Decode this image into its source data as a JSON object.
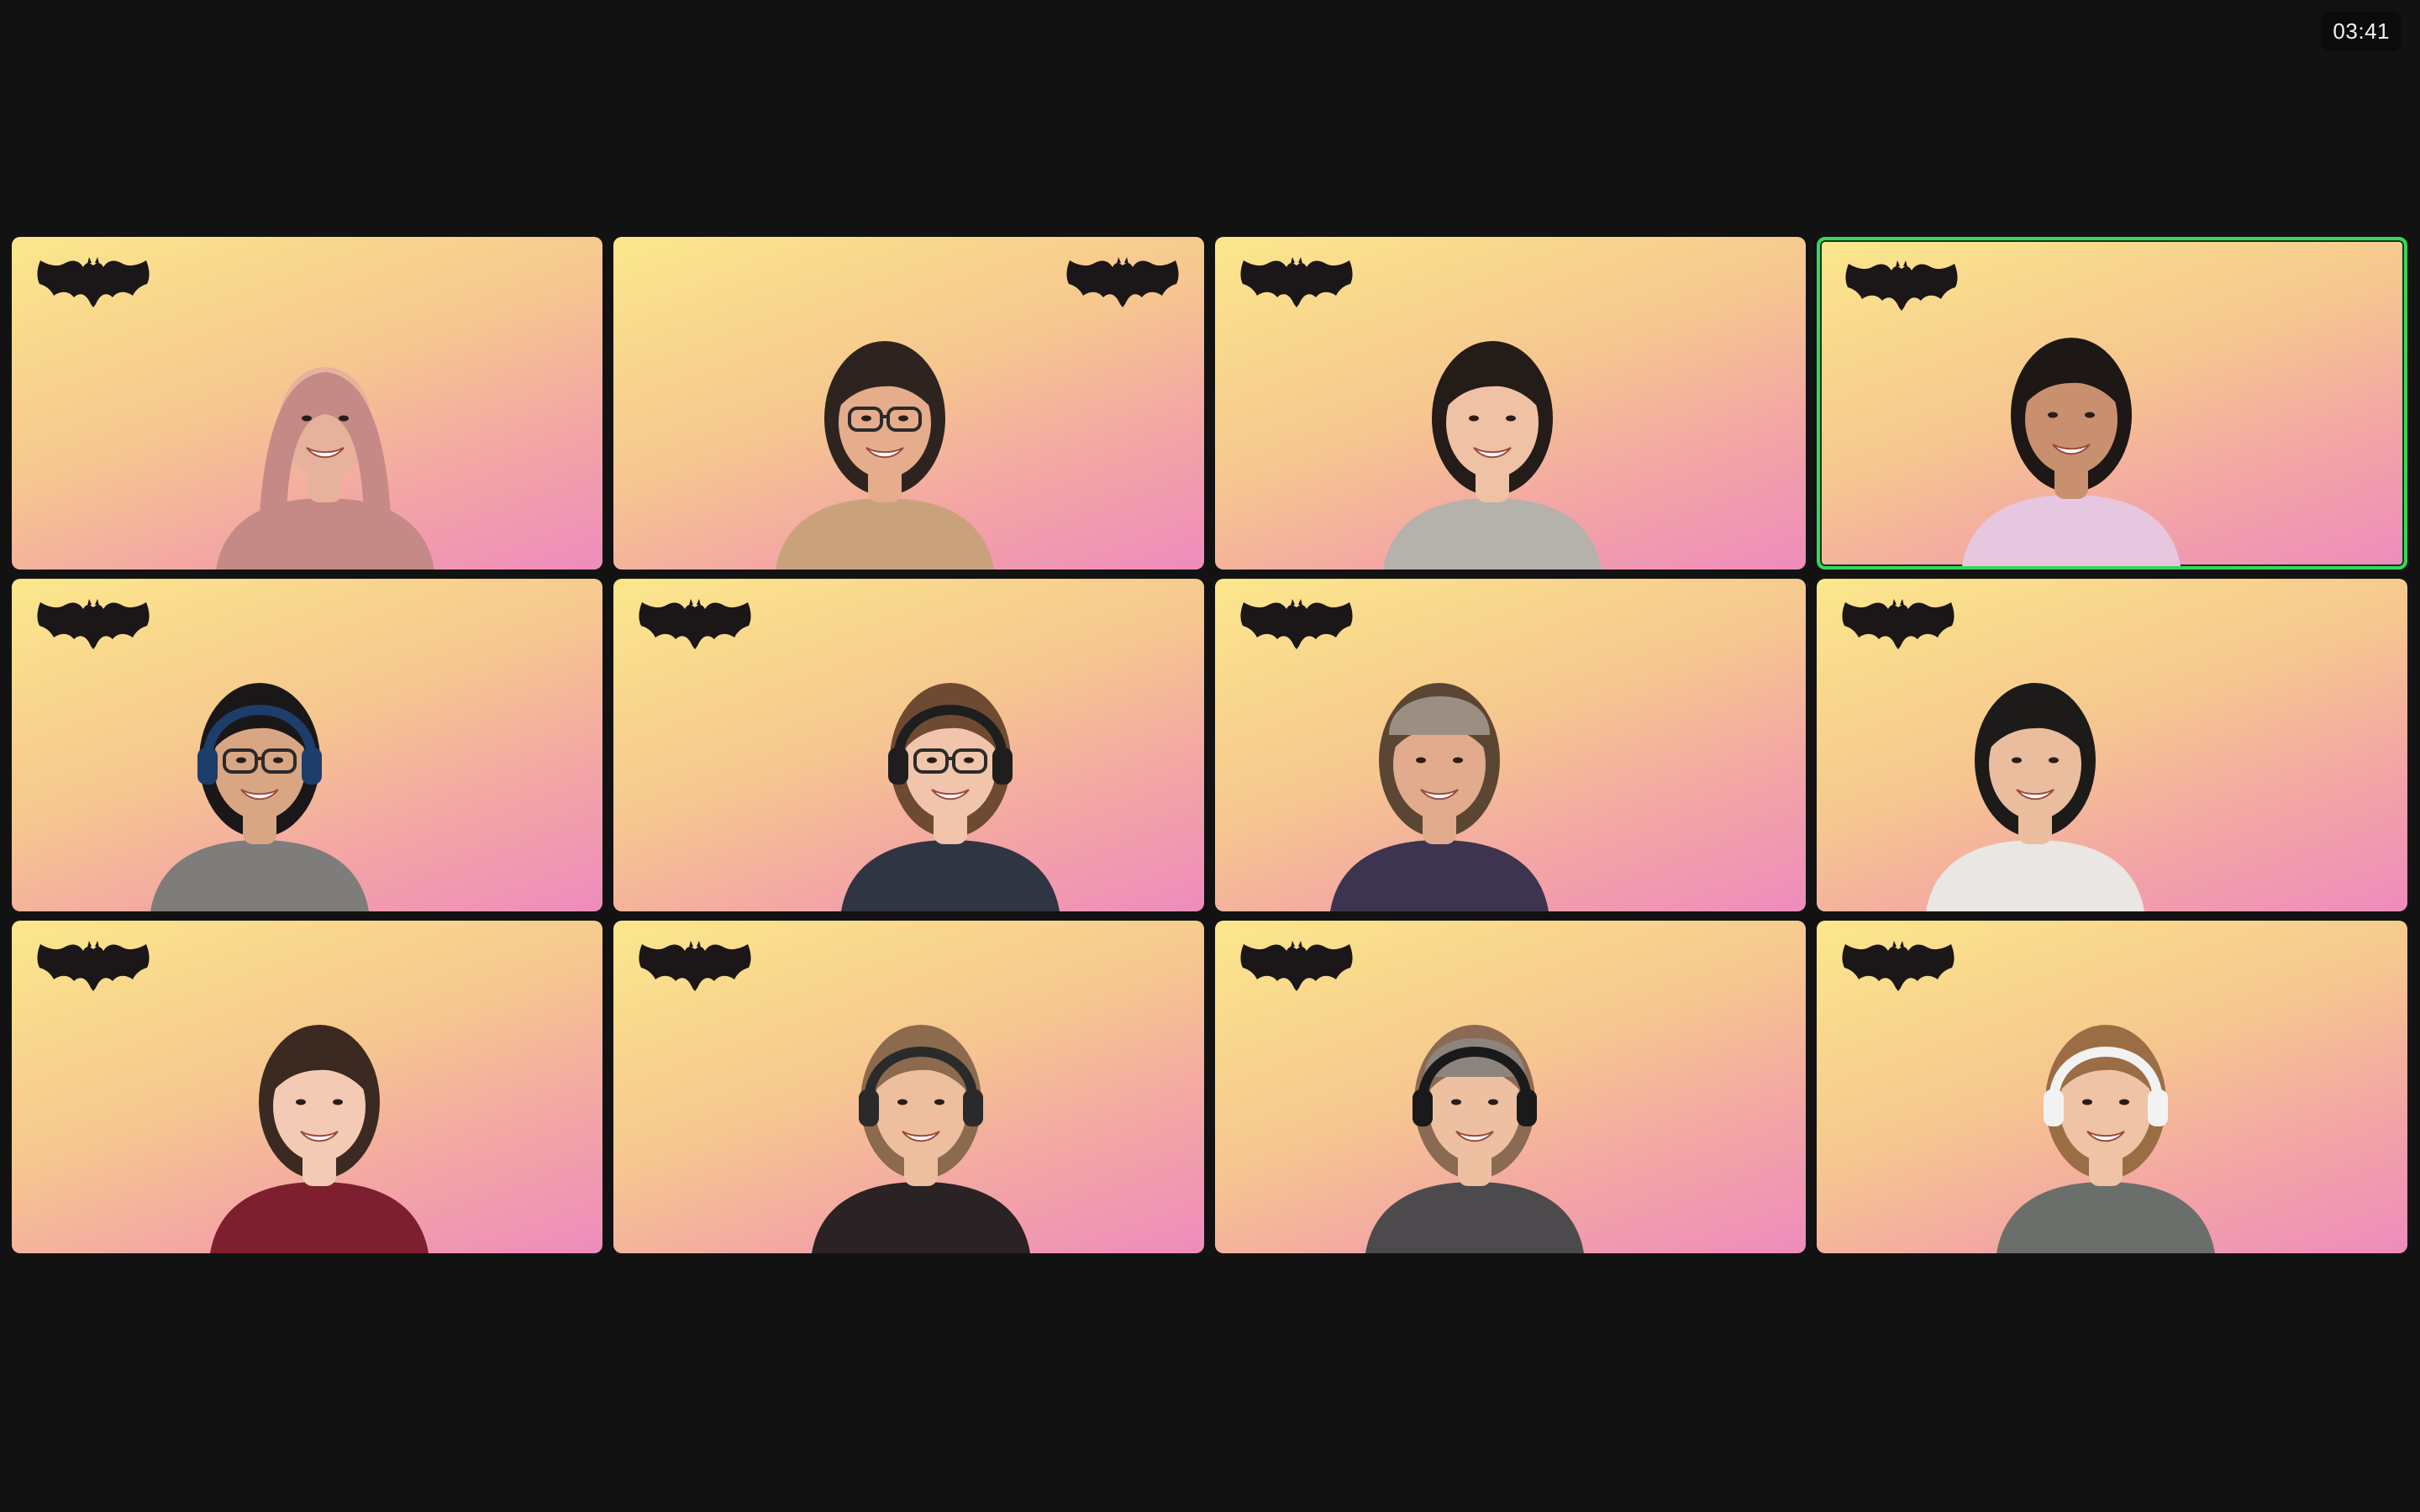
{
  "app": {
    "clock": "03:41",
    "accent_active": "#38d65a",
    "background": "#121212",
    "tile_gradient": [
      "#fbe78c",
      "#f6c78f",
      "#f3a6a4",
      "#ee8bbd"
    ],
    "overlay_icon": "bat-icon"
  },
  "participants": [
    {
      "id": "p1",
      "bat_side": "left",
      "active": false,
      "shirt": "#c58a86",
      "hair": "#b77e73",
      "skin": "#e7b29c",
      "hood": true
    },
    {
      "id": "p2",
      "bat_side": "right",
      "active": false,
      "shirt": "#c9a27c",
      "hair": "#2e241f",
      "skin": "#e5ad8c",
      "glasses": true
    },
    {
      "id": "p3",
      "bat_side": "left",
      "active": false,
      "shirt": "#b5b1ab",
      "hair": "#231c18",
      "skin": "#efc1a5"
    },
    {
      "id": "p4",
      "bat_side": "left",
      "active": true,
      "shirt": "#e7c7df",
      "hair": "#1d1715",
      "skin": "#c99070"
    },
    {
      "id": "p5",
      "bat_side": "left",
      "active": false,
      "shirt": "#7f7d7b",
      "hair": "#1a1718",
      "skin": "#d9a684",
      "headset": "#1d3d6b",
      "glasses": true
    },
    {
      "id": "p6",
      "bat_side": "left",
      "active": false,
      "shirt": "#2f3542",
      "hair": "#6e4a32",
      "skin": "#f0c5ab",
      "headset": "#1e1e1e",
      "glasses": true
    },
    {
      "id": "p7",
      "bat_side": "left",
      "active": false,
      "shirt": "#3d3550",
      "hair": "#5b4634",
      "skin": "#e2ab8d",
      "cap": "#9b8f83"
    },
    {
      "id": "p8",
      "bat_side": "left",
      "active": false,
      "shirt": "#e9e6e4",
      "hair": "#1d1a1a",
      "skin": "#e9bd9d"
    },
    {
      "id": "p9",
      "bat_side": "left",
      "active": false,
      "shirt": "#7e1f2f",
      "hair": "#3b2a22",
      "skin": "#f3cbb4"
    },
    {
      "id": "p10",
      "bat_side": "left",
      "active": false,
      "shirt": "#2a2225",
      "hair": "#8b6a4d",
      "skin": "#edbf9f",
      "headset": "#2a2a2a"
    },
    {
      "id": "p11",
      "bat_side": "left",
      "active": false,
      "shirt": "#4c4a4c",
      "hair": "#8a6a52",
      "skin": "#ecc0a1",
      "headset": "#1a1a1a",
      "cap": "#8c857d"
    },
    {
      "id": "p12",
      "bat_side": "left",
      "active": false,
      "shirt": "#6b6f6b",
      "hair": "#9a6d45",
      "skin": "#efc3a6",
      "headset": "#f2f2f2"
    }
  ]
}
